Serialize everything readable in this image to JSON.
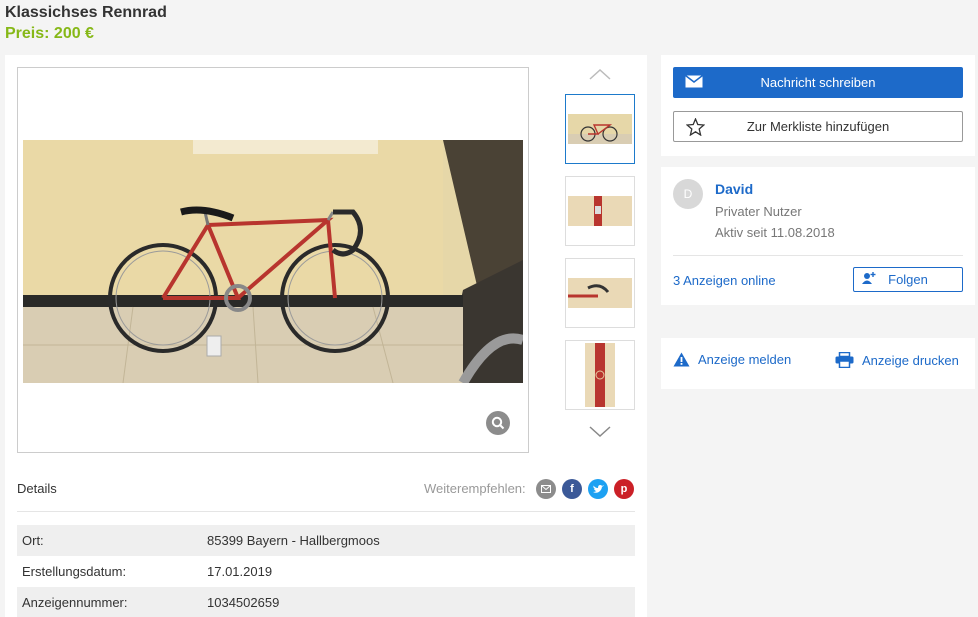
{
  "listing": {
    "title": "Klassichses Rennrad",
    "price": "Preis: 200 €"
  },
  "gallery": {
    "thumbnail_count": 4,
    "active_thumbnail": 1
  },
  "details": {
    "label": "Details",
    "share_label": "Weiterempfehlen:",
    "rows": [
      {
        "key": "Ort:",
        "value": "85399 Bayern - Hallbergmoos"
      },
      {
        "key": "Erstellungsdatum:",
        "value": "17.01.2019"
      },
      {
        "key": "Anzeigennummer:",
        "value": "1034502659"
      }
    ]
  },
  "actions": {
    "message_button": "Nachricht schreiben",
    "watchlist_button": "Zur Merkliste hinzufügen"
  },
  "seller": {
    "avatar_initial": "D",
    "name": "David",
    "type": "Privater Nutzer",
    "active_since": "Aktiv seit 11.08.2018",
    "ads_online": "3 Anzeigen online",
    "follow_button": "Folgen"
  },
  "report": {
    "report_link": "Anzeige melden",
    "print_link": "Anzeige drucken"
  },
  "colors": {
    "accent": "#1d6ac9",
    "price": "#86b817",
    "facebook": "#3b5998",
    "twitter": "#1da1f2",
    "pinterest": "#cb2027",
    "email": "#8c8c8c"
  }
}
